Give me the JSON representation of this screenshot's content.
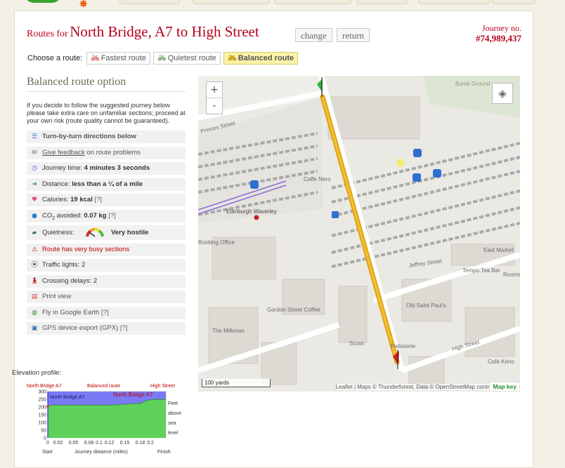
{
  "header": {
    "title_prefix": "Routes for",
    "title_name": "North Bridge, A7 to High Street",
    "change_label": "change",
    "return_label": "return",
    "journey_label": "Journey no.",
    "journey_number": "#74,989,437"
  },
  "route_chooser": {
    "label": "Choose a route:",
    "tabs": [
      {
        "label": "Fastest route",
        "icon": "bike-icon",
        "color": "#cc3333"
      },
      {
        "label": "Quietest route",
        "icon": "bike-icon",
        "color": "#3a8a2a"
      },
      {
        "label": "Balanced route",
        "icon": "bike-icon",
        "color": "#c9a21c",
        "active": true
      }
    ]
  },
  "summary": {
    "heading": "Balanced route option",
    "advice": "If you decide to follow the suggested journey below please take extra care on unfamiliar sections; proceed at your own risk (route quality cannot be guaranteed).",
    "directions": "Turn-by-turn directions below",
    "feedback_link": "Give feedback",
    "feedback_rest": "on route problems",
    "time_label": "Journey time:",
    "time_value": "4 minutes 3 seconds",
    "distance_label": "Distance:",
    "distance_value": "less than a ¼ of a mile",
    "calories_label": "Calories:",
    "calories_value": "19 kcal",
    "help": "[?]",
    "co2_label": "CO",
    "co2_sub": "2",
    "co2_rest": "avoided:",
    "co2_value": "0.07 kg",
    "quietness_label": "Quietness:",
    "quietness_value": "Very hostile",
    "busy_warning": "Route has very busy sections",
    "traffic_label": "Traffic lights:",
    "traffic_value": "2",
    "crossing_label": "Crossing delays:",
    "crossing_value": "2",
    "print": "Print view",
    "google_earth": "Fly in Google Earth",
    "gpx": "GPS device export (GPX)"
  },
  "map": {
    "zoom_in": "+",
    "zoom_out": "-",
    "scale": "100 yards",
    "attribution": "Leaflet | Maps © Thunderforest, Data © OpenStreetMap contributors",
    "map_key": "Map key",
    "labels": [
      "Princes Street",
      "Edinburgh Waverley",
      "Caffe Nero",
      "Booking Office",
      "Jeffrey Street",
      "Tempo Tea Bar",
      "Old Saint Paul's",
      "East Market",
      "Gordon Street Coffee",
      "The Milkman",
      "Scran",
      "High Street",
      "Cafe Keno",
      "Burial Ground",
      "Rooms",
      "Patisserie"
    ]
  },
  "elevation": {
    "heading": "Elevation profile:"
  },
  "chart_data": {
    "type": "area",
    "title": "",
    "top_left_label": "North Bridge  A7",
    "top_mid_label": "Balanced route",
    "top_right_label": "High Street",
    "series_labels": [
      "North Bridge  A7",
      "North Bridge  A7"
    ],
    "ylabel": "Feet above sea level",
    "xlabel": "Journey distance (miles)",
    "x_start_label": "Start",
    "x_end_label": "Finish",
    "x_ticks": [
      "0",
      "0.02",
      "0.05",
      "0.08",
      "0.1",
      "0.12",
      "0.15",
      "0.18",
      "0.2"
    ],
    "y_ticks": [
      "0",
      "50",
      "100",
      "150",
      "200",
      "250",
      "300"
    ],
    "xlim": [
      0,
      0.23
    ],
    "ylim": [
      0,
      300
    ],
    "x": [
      0,
      0.005,
      0.01,
      0.02,
      0.04,
      0.06,
      0.085,
      0.1,
      0.12,
      0.15,
      0.17,
      0.18,
      0.195,
      0.21,
      0.23
    ],
    "y": [
      203,
      210,
      212,
      212,
      212,
      212,
      212,
      212,
      212,
      217,
      222,
      222,
      245,
      248,
      248
    ],
    "colors": {
      "fill": "#5fd15a",
      "sky": "#7a7af5",
      "line": "#2a2ad8"
    }
  }
}
